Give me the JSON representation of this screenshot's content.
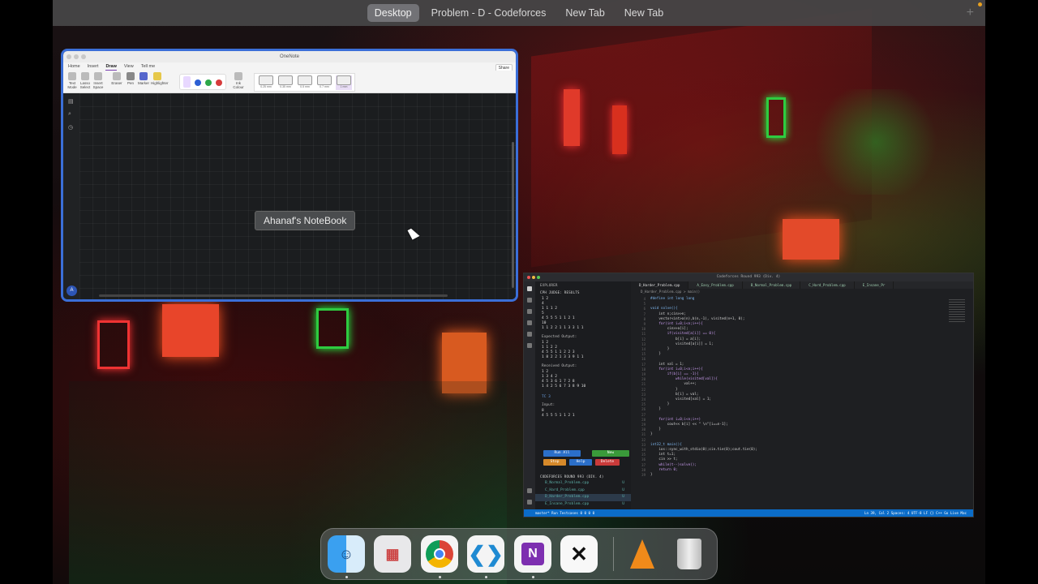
{
  "tabs": [
    "Desktop",
    "Problem - D - Codeforces",
    "New Tab",
    "New Tab"
  ],
  "onenote": {
    "window_title": "OneNote",
    "menu": [
      "Home",
      "Insert",
      "Draw",
      "View",
      "Tell me"
    ],
    "share": "Share",
    "ribbon": [
      "Text Mode",
      "Lasso Select",
      "Insert Space",
      "Eraser",
      "Pen",
      "Marker",
      "Highlighter"
    ],
    "ink_colour": "Ink Colour",
    "strokes": [
      "0.25 mm",
      "0.35 mm",
      "0.5 mm",
      "0.7 mm",
      "1 mm"
    ],
    "notebook": "Ahanaf's NoteBook",
    "avatar": "A",
    "colors": [
      "#2d5fd4",
      "#2ea84a",
      "#d63b3b"
    ]
  },
  "vscode": {
    "title": "Codeforces Round 993 (Div. 4)",
    "explorer": "EXPLORER",
    "results_header": "CPH JUDGE: RESULTS",
    "input_top": "1 2\n4\n1 1 1 2\n5\n4 5 5 5 1 1 2 1\n10\n1 1 2 2 1 1 3 3 1 1",
    "expected_label": "Expected Output:",
    "expected": "1 2\n1 1 2 2\n4 5 5 1 1 2 2 3\n1 8 2 2 1 3 3 9 1 1",
    "received_label": "Received Output:",
    "received": "1 2\n1 3 4 2\n4 5 3 6 1 7 2 8\n1 4 2 5 6 7 3 8 9 10",
    "tc": "TC 3",
    "input_label": "Input:",
    "input_bottom": "8\n4 5 5 5 1 1 2 1",
    "buttons": {
      "run_all": "Run All",
      "new": "New",
      "stop": "Stop",
      "help": "Help",
      "delete": "Delete"
    },
    "folder": "CODEFORCES ROUND 993 (DIV. 4)",
    "files": [
      "B_Normal_Problem.cpp",
      "C_Hard_Problem.cpp",
      "D_Harder_Problem.cpp",
      "E_Insane_Problem.cpp"
    ],
    "editor_tabs": [
      "D_Harder_Problem.cpp",
      "A_Easy_Problem.cpp",
      "B_Normal_Problem.cpp",
      "C_Hard_Problem.cpp",
      "E_Insane_Pr"
    ],
    "breadcrumb": "D_Harder_Problem.cpp > main()",
    "code": [
      "#define int long long",
      "",
      "void solve(){",
      "    int n;cin>>n;",
      "    vector<int>a(n),b(n,-1), visited(n+1, 0);",
      "    for(int i=0;i<n;i++){",
      "        cin>>a[i];",
      "        if(visited[a[i]] == 0){",
      "            b[i] = a[i];",
      "            visited[a[i]] = 1;",
      "        }",
      "    }",
      "",
      "    int val = 1;",
      "    for(int i=0;i<n;i++){",
      "        if(b[i] == -1){",
      "            while(visited[val]){",
      "                val++;",
      "            }",
      "            b[i] = val;",
      "            visited[val] = 1;",
      "        }",
      "    }",
      "",
      "    for(int i=0;i<n;i++)",
      "        cout<< b[i] << \" \\n\"[i==n-1];",
      "    }",
      "}",
      "",
      "int32_t main(){",
      "    ios::sync_with_stdio(0);cin.tie(0);cout.tie(0);",
      "    int t=1;",
      "    cin >> t;",
      "    while(t--)solve();",
      "    return 0;",
      "}"
    ],
    "line_start": 4,
    "status_left": "master*   Run Testcases   0 0 0   0",
    "status_right": "Ln 39, Col 2   Spaces: 4   UTF-8   LF   {} C++   Go Live   Mac"
  },
  "dock": [
    "finder-icon",
    "launchpad-icon",
    "chrome-icon",
    "vscode-icon",
    "onenote-icon",
    "capcut-icon",
    "vlc-icon",
    "trash-icon"
  ]
}
